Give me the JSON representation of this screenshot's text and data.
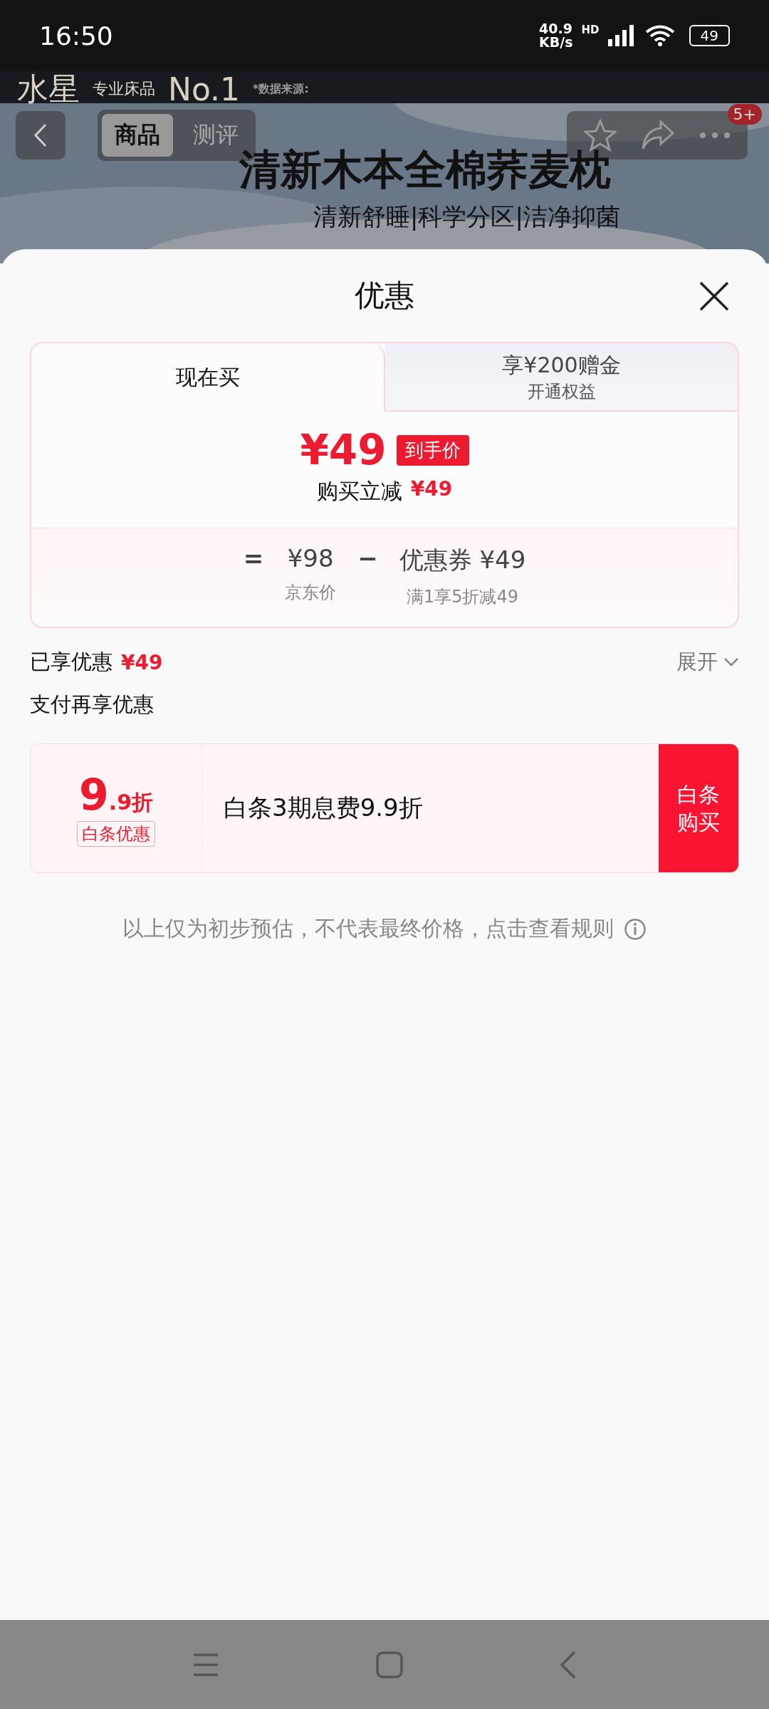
{
  "status_bar": {
    "time": "16:50",
    "net_speed": "40.9",
    "net_unit": "KB/s",
    "network": "HD",
    "battery": "49"
  },
  "background_page": {
    "brand": "水星",
    "brand_tag": "专业床品",
    "brand_slogan": "No.1",
    "source_note": "*数据来源:",
    "tabs": [
      {
        "label": "商品",
        "selected": true
      },
      {
        "label": "测评",
        "selected": false
      }
    ],
    "badge": "5+",
    "headline": "清新木本全棉荞麦枕",
    "subheadline": "清新舒睡|科学分区|洁净抑菌"
  },
  "sheet": {
    "title": "优惠",
    "tabs": [
      {
        "label": "现在买",
        "selected": true
      },
      {
        "label": "享¥200赠金",
        "sublabel": "开通权益",
        "selected": false
      }
    ],
    "price": {
      "amount": "¥49",
      "tag": "到手价",
      "reduction_label": "购买立减",
      "reduction": "¥49"
    },
    "breakdown": [
      {
        "op": "=",
        "value": "¥98",
        "caption": "京东价"
      },
      {
        "op": "−",
        "value": "优惠券 ¥49",
        "caption": "满1享5折减49"
      }
    ],
    "enjoyed": {
      "label": "已享优惠",
      "amount": "¥49",
      "toggle": "展开"
    },
    "pay_title": "支付再享优惠",
    "offers": [
      {
        "discount_big": "9",
        "discount_small": ".9折",
        "tag": "白条优惠",
        "description": "白条3期息费9.9折",
        "button": "白条购买"
      }
    ],
    "disclaimer": "以上仅为初步预估，不代表最终价格，点击查看规则"
  }
}
